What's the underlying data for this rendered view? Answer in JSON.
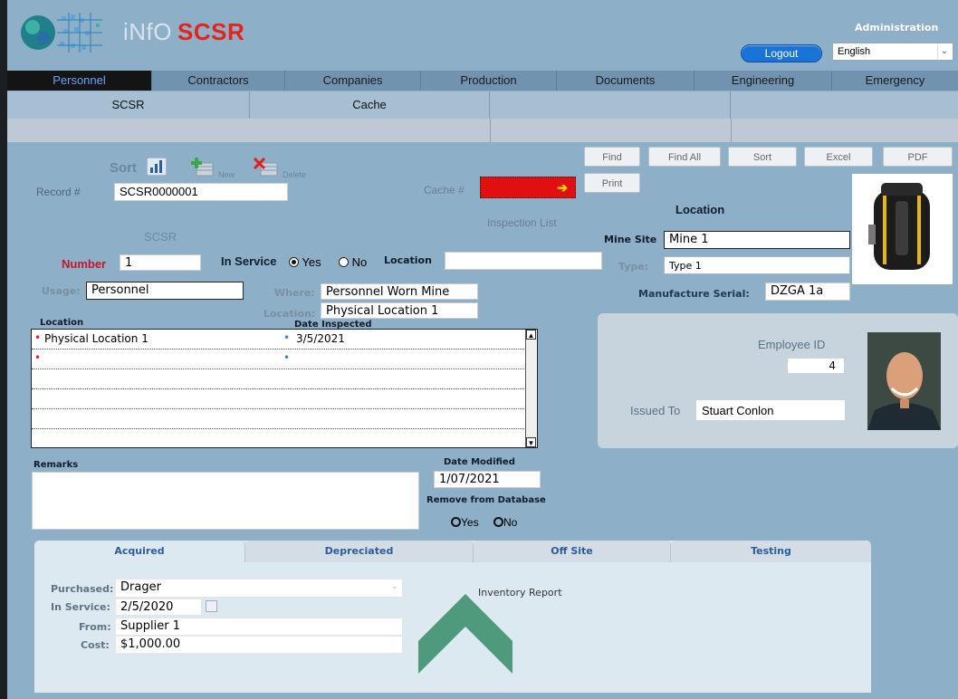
{
  "header": {
    "app_name": "iNfO",
    "app_suffix": "SCSR",
    "admin_label": "Administration",
    "logout_label": "Logout",
    "language": "English"
  },
  "nav": {
    "tabs": [
      "Personnel",
      "Contractors",
      "Companies",
      "Production",
      "Documents",
      "Engineering",
      "Emergency"
    ],
    "active": "Personnel"
  },
  "subnav": {
    "items": [
      "SCSR",
      "Cache",
      "",
      "",
      ""
    ]
  },
  "toolbar": {
    "find": "Find",
    "find_all": "Find All",
    "sort": "Sort",
    "excel": "Excel",
    "pdf": "PDF",
    "print": "Print",
    "sort_label": "Sort",
    "new_label": "New",
    "delete_label": "Delete"
  },
  "record": {
    "record_label": "Record #",
    "record_value": "SCSR0000001",
    "cache_label": "Cache #",
    "inspection_list": "Inspection List",
    "section_title": "SCSR",
    "number_label": "Number",
    "number_value": "1",
    "in_service_label": "In Service",
    "yes": "Yes",
    "no": "No",
    "location_label": "Location",
    "location_value": "",
    "usage_label": "Usage:",
    "usage_value": "Personnel",
    "where_label": "Where:",
    "where_value": "Personnel Worn Mine",
    "loc2_label": "Location:",
    "loc2_value": "Physical Location 1"
  },
  "location_panel": {
    "title": "Location",
    "mine_site_label": "Mine Site",
    "mine_site_value": "Mine 1",
    "type_label": "Type:",
    "type_value": "Type 1",
    "serial_label": "Manufacture Serial:",
    "serial_value": "DZGA 1a"
  },
  "grid": {
    "col_location": "Location",
    "col_date": "Date Inspected",
    "rows": [
      {
        "location": "Physical Location 1",
        "date": "3/5/2021"
      },
      {
        "location": "",
        "date": ""
      }
    ]
  },
  "employee": {
    "id_label": "Employee ID",
    "id_value": "4",
    "issued_label": "Issued To",
    "issued_value": "Stuart Conlon"
  },
  "remarks": {
    "label": "Remarks",
    "value": "",
    "date_modified_label": "Date Modified",
    "date_modified_value": "1/07/2021",
    "remove_label": "Remove from Database",
    "yes": "Yes",
    "no": "No"
  },
  "bottom_tabs": {
    "tabs": [
      "Acquired",
      "Depreciated",
      "Off Site",
      "Testing"
    ],
    "active": "Acquired"
  },
  "acquired": {
    "purchased_label": "Purchased:",
    "purchased_value": "Drager",
    "in_service_label": "In Service:",
    "in_service_value": "2/5/2020",
    "from_label": "From:",
    "from_value": "Supplier 1",
    "cost_label": "Cost:",
    "cost_value": "$1,000.00",
    "report_link": "Inventory Report"
  },
  "colors": {
    "accent_red": "#e52319",
    "logout_blue": "#1a73d6",
    "cache_red": "#e01010",
    "arrow_green": "#4f9a7d"
  }
}
